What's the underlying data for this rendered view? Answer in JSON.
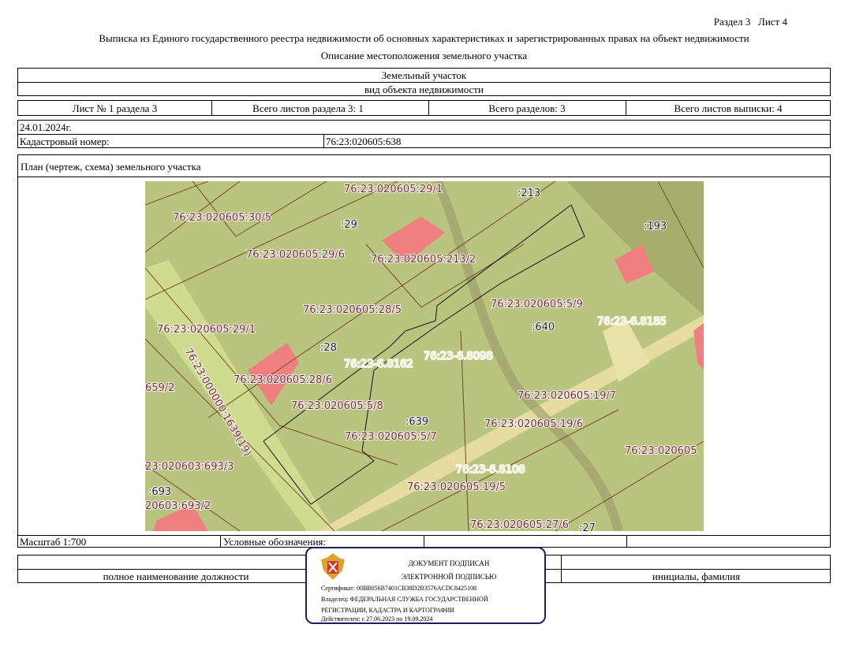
{
  "header": {
    "section": "Раздел 3",
    "sheet": "Лист 4",
    "title": "Выписка из Единого государственного реестра недвижимости об основных характеристиках и зарегистрированных правах на объект недвижимости",
    "subtitle": "Описание местоположения земельного участка"
  },
  "object": {
    "type": "Земельный участок",
    "type_caption": "вид объекта недвижимости"
  },
  "sheets": {
    "sheet_no": "Лист № 1 раздела 3",
    "total_section_sheets": "Всего листов раздела 3: 1",
    "total_sections": "Всего разделов: 3",
    "total_sheets": "Всего листов выписки: 4"
  },
  "date": "24.01.2024г.",
  "cadastral": {
    "label": "Кадастровый номер:",
    "value": "76:23:020605:638"
  },
  "plan": {
    "title": "План (чертеж, схема) земельного участка"
  },
  "map_labels": [
    "76:23:020605:29/1",
    ":213",
    "76:23:020605:30/5",
    ":29",
    ":193",
    "76:23:020605:29/6",
    "76:23:020605:213/2",
    "76:23:020605:28/5",
    "76:23:020605:5/9",
    "76:23-6.8185",
    "76:23:020605:29/1",
    ":640",
    ":28",
    "76:23-6.8098",
    "76:23-6.8162",
    "76:23:020605:28/6",
    "659/2",
    "76:23:020605:19/7",
    "76:23:020605:5/8",
    ":639",
    "76:23:020605:19/6",
    "76:23:020605:5/7",
    "76:23:020605",
    "76:23:000000:1639(19)",
    "23:020603:693/3",
    "76:23-6.8108",
    ":693",
    "76:23:020605:19/5",
    "20603:693/2",
    "76:23:020605:27/6",
    ":27"
  ],
  "footer": {
    "scale": "Масштаб 1:700",
    "legend": "Условные обозначения:",
    "position_caption": "полное наименование должности",
    "name_caption": "инициалы, фамилия"
  },
  "stamp": {
    "line1": "ДОКУМЕНТ ПОДПИСАН",
    "line2": "ЭЛЕКТРОННОЙ ПОДПИСЬЮ",
    "cert": "Сертификат: 00BB056B7401CB38D2B3576ACDC8425108",
    "owner1": "Владелец: ФЕДЕРАЛЬНАЯ СЛУЖБА ГОСУДАРСТВЕННОЙ",
    "owner2": "РЕГИСТРАЦИИ, КАДАСТРА И КАРТОГРАФИИ",
    "valid": "Действителен: с 27.06.2023 по 19.09.2024"
  },
  "colors": {
    "land": "#b9c47f",
    "building": "#f08080",
    "label": "#7a1f2b",
    "stamp_border": "#1b1f5c"
  }
}
